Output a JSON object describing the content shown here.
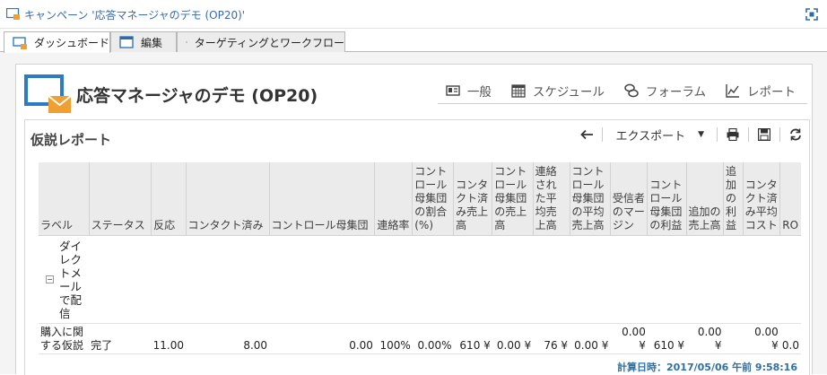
{
  "window": {
    "title": "キャンペーン '応答マネージャのデモ (OP20)'",
    "app_icon": "campaign-window-icon",
    "maximize_icon": "maximize-icon"
  },
  "tabs": [
    {
      "label": "ダッシュボード",
      "icon": "dashboard-icon",
      "active": true
    },
    {
      "label": "編集",
      "icon": "edit-icon",
      "active": false
    },
    {
      "label": "ターゲティングとワークフロー",
      "icon": "workflow-icon",
      "active": false
    }
  ],
  "page": {
    "title": "応答マネージャのデモ (OP20)",
    "nav": [
      {
        "label": "一般",
        "icon": "general-icon"
      },
      {
        "label": "スケジュール",
        "icon": "calendar-icon"
      },
      {
        "label": "フォーラム",
        "icon": "forum-icon"
      },
      {
        "label": "レポート",
        "icon": "report-chart-icon"
      }
    ]
  },
  "report": {
    "title": "仮説レポート",
    "export_label": "エクスポート",
    "columns": [
      "ラベル",
      "ステータス",
      "反応",
      "コンタクト済み",
      "コントロール母集団",
      "連絡率",
      "コントロール母集団の割合(%)",
      "コンタクト済み売上高",
      "コントロール母集団の売上高",
      "連絡された平均売上高",
      "コントロール母集団の平均売上高",
      "受信者のマージン",
      "コントロール母集団の利益",
      "追加の売上高",
      "追加の利益",
      "コンタクト済み平均コスト",
      "RO"
    ],
    "group_label": "ダイレクトメールで配信",
    "rows": [
      {
        "cells": [
          "購入に関する仮説",
          "完了",
          "11.00",
          "8.00",
          "0.00",
          "100%",
          "0.00%",
          "610 ¥",
          "0.00 ¥",
          "76 ¥",
          "0.00 ¥",
          "0.00 ¥",
          "610 ¥",
          "0.00 ¥",
          "",
          "0.00 ¥",
          "0.0"
        ]
      }
    ],
    "computed_at": "計算日時：2017/05/06 午前 9:58:16"
  },
  "colors": {
    "accent_blue": "#2d7ac7",
    "title_blue": "#3a6aa8",
    "envelope_orange": "#f0a030"
  }
}
